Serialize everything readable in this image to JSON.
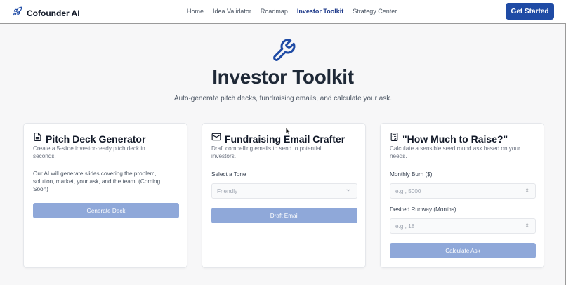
{
  "brand": {
    "name": "Cofounder AI",
    "icon": "rocket-icon",
    "color": "#1f4ba5"
  },
  "nav": {
    "items": [
      {
        "label": "Home",
        "active": false
      },
      {
        "label": "Idea Validator",
        "active": false
      },
      {
        "label": "Roadmap",
        "active": false
      },
      {
        "label": "Investor Toolkit",
        "active": true
      },
      {
        "label": "Strategy Center",
        "active": false
      }
    ],
    "cta_label": "Get Started"
  },
  "hero": {
    "icon": "wrench-icon",
    "title": "Investor Toolkit",
    "subtitle": "Auto-generate pitch decks, fundraising emails, and calculate your ask."
  },
  "cards": {
    "pitch": {
      "icon": "document-icon",
      "title": "Pitch Deck Generator",
      "desc_line1": "Create a 5-slide investor-ready pitch deck in",
      "desc_line2": "seconds.",
      "body_line1": "Our AI will generate slides covering the problem,",
      "body_line2": "solution, market, your ask, and the team. (Coming",
      "body_line3": "Soon)",
      "button_label": "Generate Deck"
    },
    "email": {
      "icon": "mail-icon",
      "title": "Fundraising Email Crafter",
      "desc_line1": "Draft compelling emails to send to potential",
      "desc_line2": "investors.",
      "tone_label": "Select a Tone",
      "tone_value": "Friendly",
      "button_label": "Draft Email"
    },
    "raise": {
      "icon": "calculator-icon",
      "title": "\"How Much to Raise?\"",
      "desc_line1": "Calculate a sensible seed round ask based on your",
      "desc_line2": "needs.",
      "burn_label": "Monthly Burn ($)",
      "burn_placeholder": "e.g., 5000",
      "runway_label": "Desired Runway (Months)",
      "runway_placeholder": "e.g., 18",
      "button_label": "Calculate Ask"
    }
  },
  "colors": {
    "accent": "#1f4ba5",
    "button_disabled": "#8fa8d9"
  }
}
